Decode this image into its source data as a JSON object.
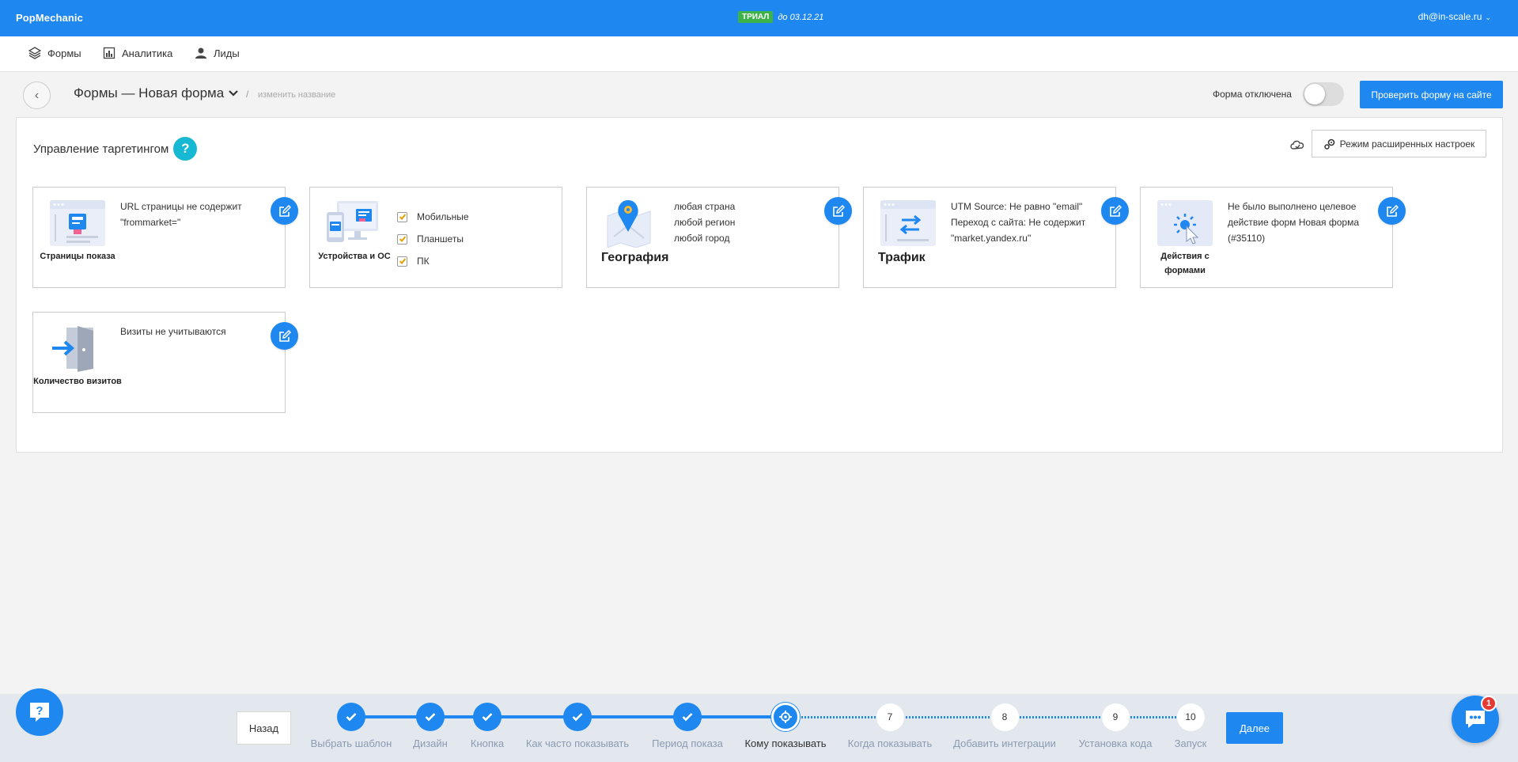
{
  "app": {
    "brand": "PopMechanic",
    "trial_badge": "ТРИАЛ",
    "trial_date": "до 03.12.21",
    "account": "dh@in-scale.ru"
  },
  "nav": {
    "forms": "Формы",
    "analytics": "Аналитика",
    "leads": "Лиды"
  },
  "header": {
    "title": "Формы — Новая форма",
    "separator": "/",
    "rename": "изменить название",
    "status_label": "Форма отключена",
    "toggle_on": false,
    "check_button": "Проверить форму на сайте"
  },
  "targeting": {
    "title": "Управление таргетингом",
    "help": "?",
    "advanced_button": "Режим расширенных настроек",
    "cards": {
      "pages": {
        "label": "Страницы показа",
        "desc": "URL страницы не содержит \"frommarket=\""
      },
      "devices": {
        "label": "Устройства и ОС",
        "options": [
          {
            "label": "Мобильные",
            "checked": true
          },
          {
            "label": "Планшеты",
            "checked": true
          },
          {
            "label": "ПК",
            "checked": true
          }
        ]
      },
      "geo": {
        "label": "География",
        "line1": "любая страна",
        "line2": "любой регион",
        "line3": "любой город"
      },
      "traffic": {
        "label": "Трафик",
        "desc": "UTM Source: Не равно \"email\" Переход с сайта: Не содержит \"market.yandex.ru\""
      },
      "actions": {
        "label": "Действия с формами",
        "desc": "Не было выполнено целевое действие форм Новая форма (#35110)"
      },
      "visits": {
        "label": "Количество визитов",
        "desc": "Визиты не учитываются"
      }
    }
  },
  "wizard": {
    "back": "Назад",
    "next": "Далее",
    "steps": [
      {
        "label": "Выбрать шаблон",
        "state": "done"
      },
      {
        "label": "Дизайн",
        "state": "done"
      },
      {
        "label": "Кнопка",
        "state": "done"
      },
      {
        "label": "Как часто показывать",
        "state": "done"
      },
      {
        "label": "Период показа",
        "state": "done"
      },
      {
        "label": "Кому показывать",
        "state": "current"
      },
      {
        "label": "Когда показывать",
        "state": "todo",
        "num": "7"
      },
      {
        "label": "Добавить интеграции",
        "state": "todo",
        "num": "8"
      },
      {
        "label": "Установка кода",
        "state": "todo",
        "num": "9"
      },
      {
        "label": "Запуск",
        "state": "todo",
        "num": "10"
      }
    ]
  },
  "help_fab": "?",
  "chat_badge": "1",
  "colors": {
    "primary": "#1e88f0",
    "trial": "#3db249",
    "help": "#17b8d3",
    "badge": "#e53935"
  }
}
